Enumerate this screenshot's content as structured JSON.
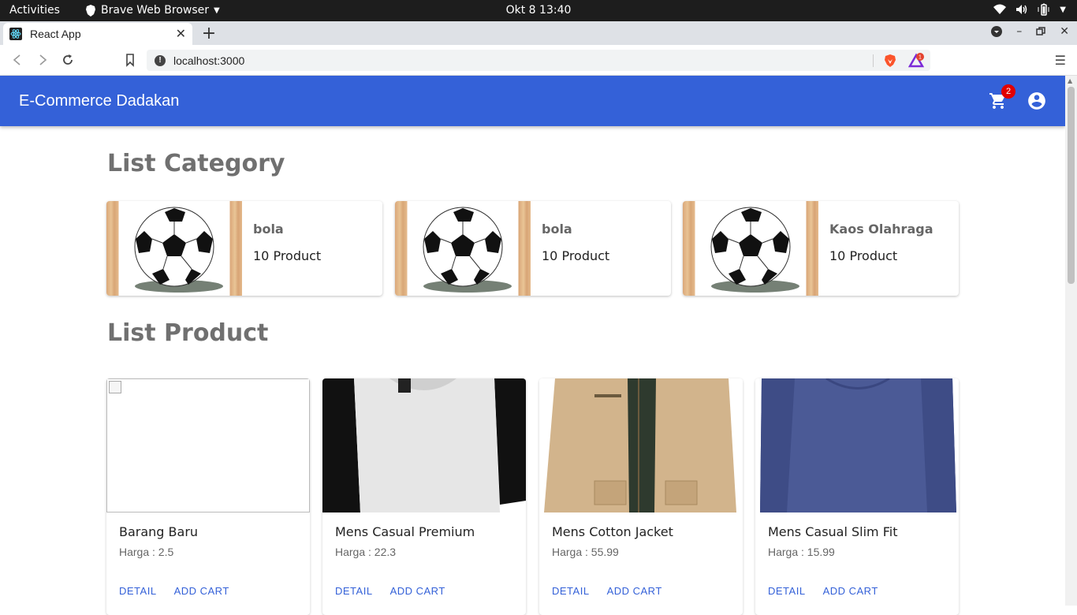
{
  "os_bar": {
    "activities": "Activities",
    "app_name": "Brave Web Browser",
    "clock": "Okt 8  13:40"
  },
  "browser": {
    "tab_title": "React App",
    "url": "localhost:3000",
    "rewards_badge": "1"
  },
  "app": {
    "brand": "E-Commerce Dadakan",
    "cart_count": "2",
    "accent_color": "#3461d8"
  },
  "categories": {
    "heading": "List Category",
    "items": [
      {
        "name": "bola",
        "count": "10 Product"
      },
      {
        "name": "bola",
        "count": "10 Product"
      },
      {
        "name": "Kaos Olahraga",
        "count": "10 Product"
      }
    ]
  },
  "products": {
    "heading": "List Product",
    "items": [
      {
        "name": "Barang Baru",
        "price": "Harga : 2.5",
        "detail": "DETAIL",
        "add": "ADD CART"
      },
      {
        "name": "Mens Casual Premium",
        "price": "Harga : 22.3",
        "detail": "DETAIL",
        "add": "ADD CART"
      },
      {
        "name": "Mens Cotton Jacket",
        "price": "Harga : 55.99",
        "detail": "DETAIL",
        "add": "ADD CART"
      },
      {
        "name": "Mens Casual Slim Fit",
        "price": "Harga : 15.99",
        "detail": "DETAIL",
        "add": "ADD CART"
      }
    ]
  }
}
